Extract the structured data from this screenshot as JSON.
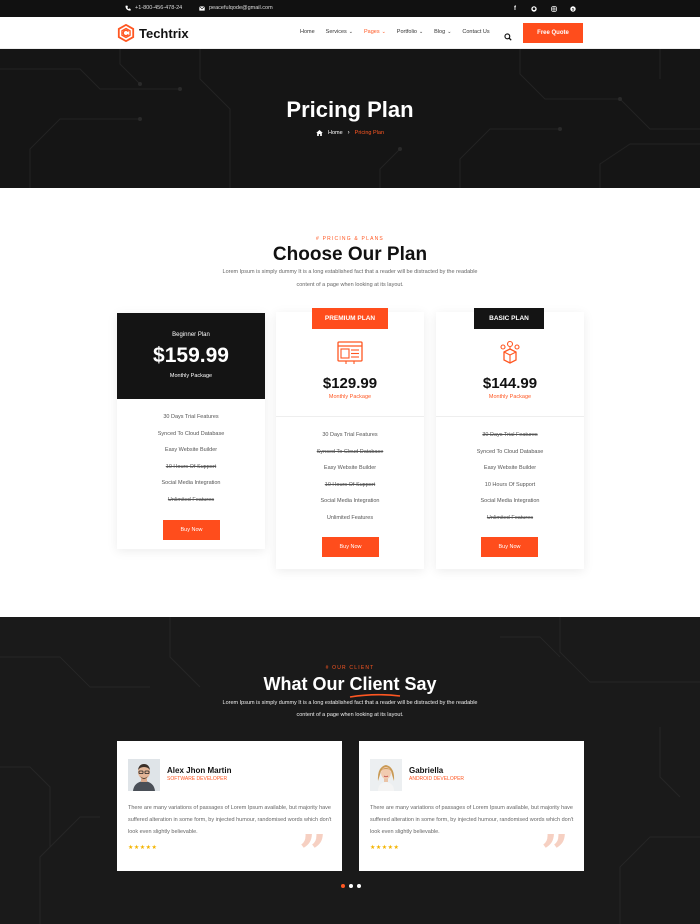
{
  "topbar": {
    "phone": "+1-800-456-478-24",
    "email": "peacefulqode@gmail.com",
    "social_icons": [
      "facebook-icon",
      "github-icon",
      "instagram-icon",
      "skype-icon"
    ]
  },
  "header": {
    "logo_text": "Techtrix",
    "nav": [
      {
        "label": "Home",
        "dropdown": false
      },
      {
        "label": "Services",
        "dropdown": true
      },
      {
        "label": "Pages",
        "dropdown": true,
        "active": true
      },
      {
        "label": "Portfolio",
        "dropdown": true
      },
      {
        "label": "Blog",
        "dropdown": true
      },
      {
        "label": "Contact Us",
        "dropdown": false
      }
    ],
    "cta_label": "Free Quote"
  },
  "hero": {
    "title": "Pricing Plan",
    "breadcrumb_home": "Home",
    "breadcrumb_current": "Pricing Plan"
  },
  "pricing": {
    "eyebrow": "# PRICING & PLANS",
    "title": "Choose Our Plan",
    "desc_line1": "Lorem Ipsum is simply dummy It is a long established fact that a reader will be distracted by the readable",
    "desc_line2": "content of a page when looking at its layout.",
    "plans": [
      {
        "name": "Beginner Plan",
        "price": "$159.99",
        "period": "Monthly Package",
        "features": [
          "30 Days Trial Features",
          "Synced To Cloud Database",
          "Easy Website Builder",
          "10 Hours Of Support",
          "Social Media Integration",
          "Unlimited Features"
        ],
        "struck": [
          false,
          false,
          false,
          true,
          false,
          true
        ],
        "button": "Buy Now"
      },
      {
        "ribbon": "PREMIUM PLAN",
        "icon": "website-layout-icon",
        "price": "$129.99",
        "period": "Monthly Package",
        "features": [
          "30 Days Trial Features",
          "Synced To Cloud Database",
          "Easy Website Builder",
          "10 Hours Of Support",
          "Social Media Integration",
          "Unlimited Features"
        ],
        "struck": [
          false,
          true,
          false,
          true,
          false,
          false
        ],
        "button": "Buy Now"
      },
      {
        "ribbon": "BASIC PLAN",
        "icon": "idea-box-icon",
        "price": "$144.99",
        "period": "Monthly Package",
        "features": [
          "30 Days Trial Features",
          "Synced To Cloud Database",
          "Easy Website Builder",
          "10 Hours Of Support",
          "Social Media Integration",
          "Unlimited Features"
        ],
        "struck": [
          true,
          false,
          false,
          false,
          false,
          true
        ],
        "button": "Buy Now"
      }
    ]
  },
  "testimonials": {
    "eyebrow": "# OUR CLIENT",
    "title_part1": "What Our ",
    "title_highlight": "Client",
    "title_part2": " Say",
    "desc_line1": "Lorem Ipsum is simply dummy It is a long established fact that a reader will be distracted by the readable",
    "desc_line2": "content of a page when looking at its layout.",
    "items": [
      {
        "name": "Alex Jhon Martin",
        "role": "SOFTWARE DEVELOPER",
        "text": "There are many variations of passages of Lorem Ipsum available, but majority have suffered alteration in some form, by injected humour, randomised words which don't look even slightly believable.",
        "rating": 5
      },
      {
        "name": "Gabriella",
        "role": "ANDROID DEVELOPER",
        "text": "There are many variations of passages of Lorem Ipsum available, but majority have suffered alteration in some form, by injected humour, randomised words which don't look even slightly believable.",
        "rating": 5
      }
    ],
    "pagination_count": 3,
    "pagination_active": 0
  },
  "colors": {
    "accent": "#ff5722",
    "dark": "#151515"
  }
}
